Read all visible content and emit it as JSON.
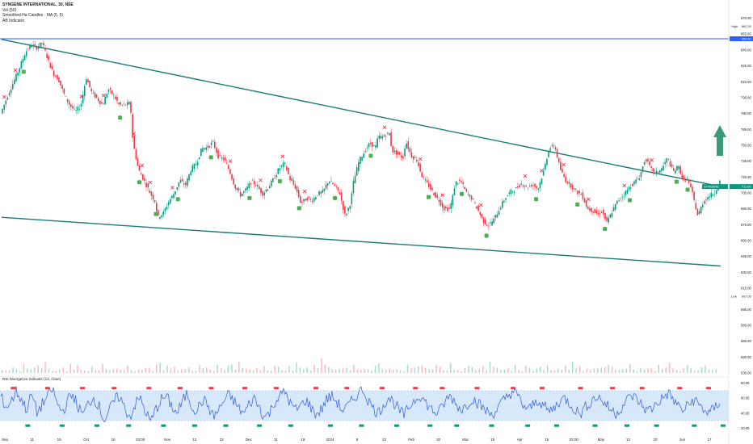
{
  "chart_data": {
    "type": "line",
    "symbol": "SYNGENE INTERNATIONAL",
    "interval": "30",
    "exchange": "NSE",
    "legend": [
      "Vol (50)",
      "Smoothed Ha Candles · MA (5, 5)",
      "AB Indicator"
    ],
    "price_axis": {
      "min": 535,
      "max": 875,
      "ticks": [
        "870.00",
        "855.00",
        "840.00",
        "825.00",
        "810.00",
        "795.00",
        "780.00",
        "765.00",
        "750.00",
        "735.00",
        "720.00",
        "705.00",
        "690.00",
        "675.00",
        "660.00",
        "645.00",
        "630.00",
        "615.00",
        "595.00",
        "580.00",
        "565.00",
        "550.00",
        "535.00"
      ]
    },
    "price_badges": {
      "high_label": "High",
      "high_value": "862.25",
      "line_value": "850.60",
      "current_symbol": "SYNGENE",
      "current_value": "711.00",
      "low_label": "Low",
      "low_value": "607.55"
    },
    "horizontal_level": 850.6,
    "x_ticks": [
      "Sep",
      "11",
      "19",
      "Oct",
      "16",
      "03:00",
      "Nov",
      "13",
      "22",
      "Dec",
      "11",
      "19",
      "2024",
      "8",
      "22",
      "Feb",
      "20",
      "Mar",
      "18",
      "Apr",
      "15",
      "03:00",
      "May",
      "13",
      "20",
      "Jun",
      "17"
    ],
    "price": [
      [
        0,
        780
      ],
      [
        3,
        800
      ],
      [
        6,
        818
      ],
      [
        9,
        838
      ],
      [
        11,
        845
      ],
      [
        13,
        842
      ],
      [
        15,
        847
      ],
      [
        17,
        832
      ],
      [
        19,
        818
      ],
      [
        21,
        812
      ],
      [
        23,
        798
      ],
      [
        25,
        788
      ],
      [
        27,
        782
      ],
      [
        29,
        787
      ],
      [
        31,
        814
      ],
      [
        33,
        800
      ],
      [
        35,
        794
      ],
      [
        37,
        788
      ],
      [
        39,
        803
      ],
      [
        41,
        797
      ],
      [
        43,
        788
      ],
      [
        45,
        788
      ],
      [
        47,
        790
      ],
      [
        48,
        752
      ],
      [
        50,
        727
      ],
      [
        52,
        717
      ],
      [
        54,
        706
      ],
      [
        56,
        697
      ],
      [
        57,
        682
      ],
      [
        59,
        686
      ],
      [
        61,
        697
      ],
      [
        63,
        705
      ],
      [
        65,
        717
      ],
      [
        67,
        712
      ],
      [
        69,
        727
      ],
      [
        71,
        733
      ],
      [
        73,
        747
      ],
      [
        75,
        748
      ],
      [
        77,
        753
      ],
      [
        79,
        739
      ],
      [
        81,
        737
      ],
      [
        83,
        726
      ],
      [
        85,
        711
      ],
      [
        87,
        703
      ],
      [
        89,
        708
      ],
      [
        91,
        716
      ],
      [
        93,
        712
      ],
      [
        95,
        704
      ],
      [
        97,
        710
      ],
      [
        99,
        718
      ],
      [
        101,
        728
      ],
      [
        103,
        733
      ],
      [
        105,
        718
      ],
      [
        107,
        710
      ],
      [
        109,
        695
      ],
      [
        111,
        700
      ],
      [
        113,
        698
      ],
      [
        115,
        704
      ],
      [
        117,
        706
      ],
      [
        119,
        717
      ],
      [
        121,
        712
      ],
      [
        123,
        705
      ],
      [
        125,
        683
      ],
      [
        127,
        696
      ],
      [
        128,
        715
      ],
      [
        130,
        735
      ],
      [
        132,
        744
      ],
      [
        134,
        752
      ],
      [
        136,
        748
      ],
      [
        137,
        758
      ],
      [
        139,
        758
      ],
      [
        141,
        762
      ],
      [
        142,
        745
      ],
      [
        144,
        742
      ],
      [
        146,
        738
      ],
      [
        147,
        754
      ],
      [
        149,
        740
      ],
      [
        151,
        736
      ],
      [
        153,
        720
      ],
      [
        155,
        713
      ],
      [
        157,
        705
      ],
      [
        159,
        698
      ],
      [
        161,
        690
      ],
      [
        163,
        690
      ],
      [
        164,
        701
      ],
      [
        165,
        715
      ],
      [
        167,
        716
      ],
      [
        169,
        705
      ],
      [
        171,
        700
      ],
      [
        173,
        690
      ],
      [
        175,
        679
      ],
      [
        177,
        674
      ],
      [
        179,
        680
      ],
      [
        181,
        690
      ],
      [
        183,
        700
      ],
      [
        185,
        706
      ],
      [
        187,
        709
      ],
      [
        189,
        714
      ],
      [
        191,
        710
      ],
      [
        193,
        713
      ],
      [
        195,
        709
      ],
      [
        197,
        725
      ],
      [
        199,
        747
      ],
      [
        201,
        750
      ],
      [
        203,
        728
      ],
      [
        205,
        717
      ],
      [
        207,
        712
      ],
      [
        209,
        706
      ],
      [
        211,
        703
      ],
      [
        213,
        690
      ],
      [
        215,
        688
      ],
      [
        217,
        684
      ],
      [
        218,
        689
      ],
      [
        220,
        677
      ],
      [
        222,
        688
      ],
      [
        224,
        698
      ],
      [
        226,
        703
      ],
      [
        228,
        710
      ],
      [
        230,
        715
      ],
      [
        232,
        721
      ],
      [
        234,
        738
      ],
      [
        236,
        727
      ],
      [
        238,
        724
      ],
      [
        240,
        728
      ],
      [
        242,
        738
      ],
      [
        244,
        725
      ],
      [
        246,
        730
      ],
      [
        248,
        715
      ],
      [
        249,
        720
      ],
      [
        251,
        705
      ],
      [
        253,
        683
      ],
      [
        255,
        697
      ],
      [
        257,
        702
      ],
      [
        259,
        705
      ],
      [
        261,
        716
      ]
    ],
    "channel_upper": [
      [
        0,
        850
      ],
      [
        261,
        711
      ]
    ],
    "channel_lower": [
      [
        0,
        682
      ],
      [
        261,
        636
      ]
    ],
    "buy_markers": [
      8,
      43,
      50,
      56,
      64,
      76,
      90,
      101,
      108,
      121,
      134,
      155,
      167,
      176,
      194,
      209,
      219,
      228,
      245,
      249
    ],
    "sell_markers": [
      1,
      5,
      29,
      37,
      48,
      51,
      54,
      62,
      83,
      94,
      102,
      110,
      139,
      152,
      160,
      174,
      190,
      196,
      204,
      213,
      226,
      236
    ],
    "volume": [
      2,
      3,
      2,
      4,
      3,
      2,
      5,
      3,
      2,
      3,
      4,
      3,
      6,
      3,
      2,
      3,
      2,
      4,
      3,
      8,
      5,
      4,
      3,
      3,
      2,
      3,
      4,
      3,
      5,
      4,
      3,
      2,
      2,
      3,
      4,
      5,
      3,
      2,
      3,
      4,
      3,
      3,
      2,
      4,
      5,
      3,
      6,
      4,
      3,
      2,
      3,
      4,
      3,
      2,
      3,
      5,
      4,
      3,
      2,
      3,
      4,
      3,
      2,
      4,
      5,
      3,
      7,
      5,
      3,
      2
    ],
    "rsi_axis": {
      "min": 15,
      "max": 85,
      "ticks": [
        "80.00",
        "60.00",
        "40.00",
        "20.00"
      ]
    },
    "rsi_band": [
      30,
      70
    ],
    "rsi_label": "RSI Divergence Indicator (14, close)",
    "rsi_values": [
      62,
      48,
      55,
      70,
      58,
      45,
      66,
      40,
      52,
      61,
      73,
      50,
      42,
      58,
      65,
      47,
      38,
      55,
      60,
      49,
      30,
      44,
      57,
      63,
      45,
      35,
      52,
      60,
      41,
      28,
      46,
      58,
      62,
      50,
      39,
      53,
      67,
      48,
      44,
      58,
      51,
      36,
      42,
      55,
      64,
      57,
      46,
      39,
      52,
      60,
      48,
      34,
      41,
      56,
      63,
      69,
      52,
      44,
      50,
      58,
      47,
      38,
      45,
      59,
      62,
      55,
      44,
      48,
      57,
      66,
      72,
      58,
      46,
      40,
      52,
      61,
      54,
      43,
      37,
      49,
      58,
      65,
      55,
      47,
      40,
      44,
      57,
      63,
      52,
      45,
      50,
      60,
      55,
      48,
      42,
      38,
      46,
      55,
      63,
      70,
      62,
      50,
      44,
      52,
      58,
      49,
      42,
      47,
      56,
      60,
      53,
      45,
      39,
      48,
      55,
      62,
      59,
      51,
      44,
      40,
      48,
      57,
      64,
      58,
      50,
      43,
      47,
      55,
      60,
      67,
      58,
      49,
      43,
      52,
      58,
      51,
      44,
      40,
      47,
      56
    ],
    "rsi_x_ticks": [
      "Sep",
      "11",
      "19",
      "Oct",
      "16",
      "03:00",
      "Nov",
      "13",
      "22",
      "Dec",
      "11",
      "19",
      "2024",
      "8",
      "22",
      "Feb",
      "20",
      "Mar",
      "18",
      "Apr",
      "15",
      "03:00",
      "May",
      "13",
      "20",
      "Jun",
      "17"
    ],
    "colors": {
      "bull": "#089981",
      "bear": "#f23645",
      "channel": "#1a7a74",
      "hline": "#2962ff",
      "arrow": "#3a9a78",
      "rsi": "#2c59d6",
      "band": "#d8e8fb",
      "marker_buy": "#4caf50",
      "marker_sell": "#f23645"
    }
  }
}
